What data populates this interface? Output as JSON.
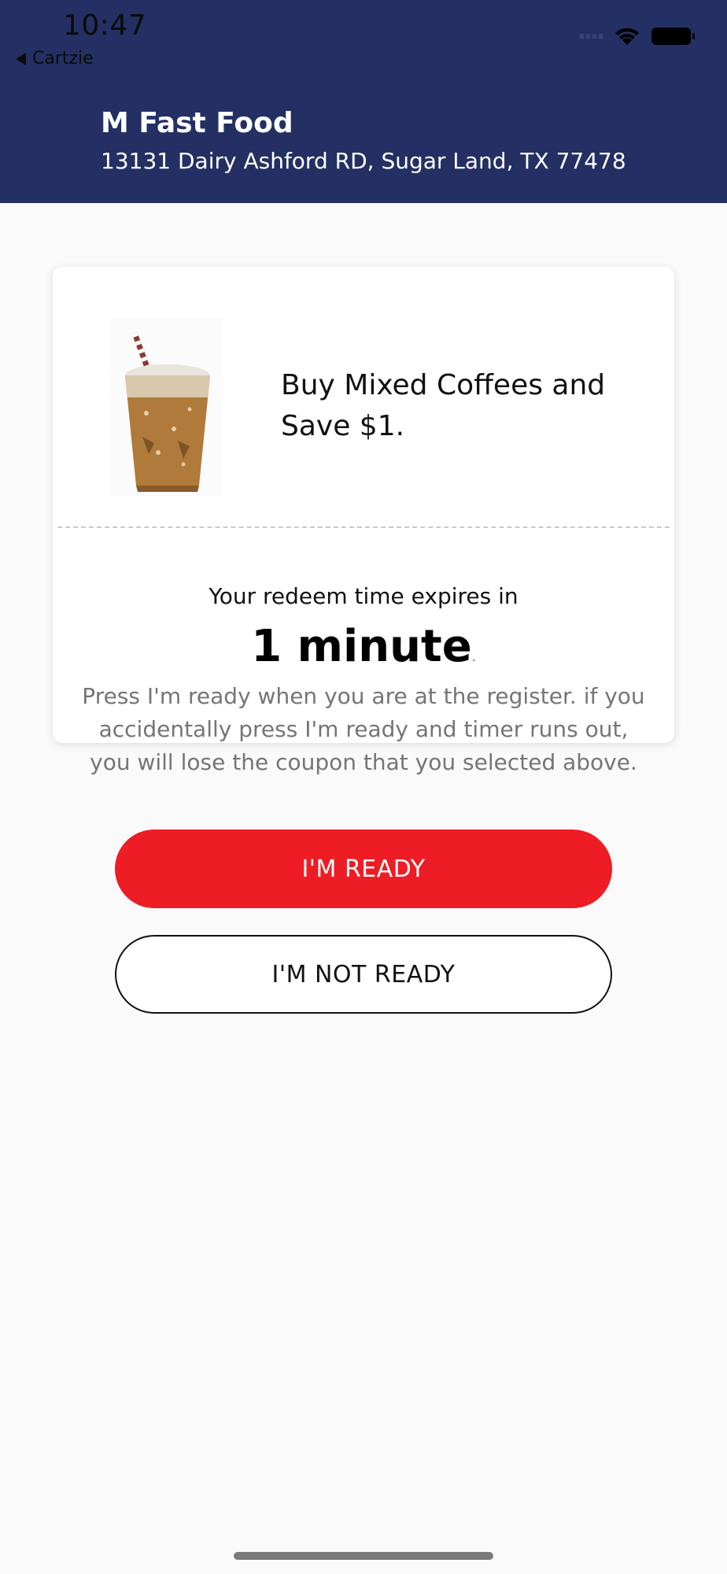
{
  "status_bar": {
    "time": "10:47",
    "back_label": "Cartzie"
  },
  "header": {
    "store_name": "M Fast Food",
    "address": "13131 Dairy Ashford RD, Sugar Land, TX 77478",
    "background_color": "#243063"
  },
  "coupon": {
    "image_icon": "iced-coffee-image",
    "title": "Buy Mixed Coffees and Save $1."
  },
  "timer": {
    "label": "Your redeem time expires in",
    "value": "1 minute",
    "value_suffix": ".",
    "instructions": "Press I'm ready when you are at the register. if you accidentally press I'm ready and timer runs out, you will lose the coupon that you selected above."
  },
  "actions": {
    "ready_label": "I'M READY",
    "not_ready_label": "I'M NOT READY",
    "ready_color": "#ee1c25"
  }
}
